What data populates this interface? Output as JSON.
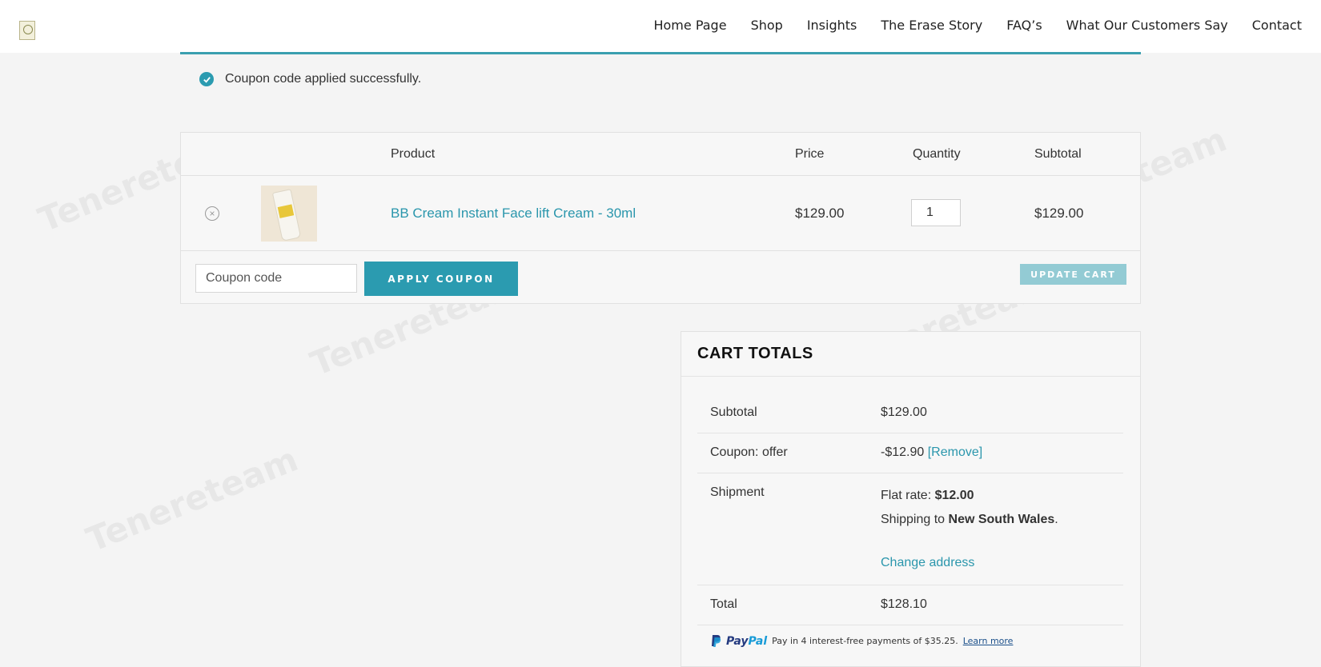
{
  "header": {
    "logo_name": "leaf-logo-icon",
    "nav": [
      "Home Page",
      "Shop",
      "Insights",
      "The Erase Story",
      "FAQ’s",
      "What Our Customers Say",
      "Contact"
    ]
  },
  "notice": {
    "text": "Coupon code applied successfully."
  },
  "cart": {
    "columns": [
      "Product",
      "Price",
      "Quantity",
      "Subtotal"
    ],
    "item": {
      "name": "BB Cream Instant Face lift Cream - 30ml",
      "price": "$129.00",
      "quantity": "1",
      "subtotal": "$129.00"
    },
    "coupon_placeholder": "Coupon code",
    "apply_label": "APPLY COUPON",
    "update_label": "UPDATE CART"
  },
  "totals": {
    "title": "CART TOTALS",
    "subtotal_label": "Subtotal",
    "subtotal": "$129.00",
    "coupon_label": "Coupon: offer",
    "coupon_value": "-$12.90",
    "coupon_remove": "[Remove]",
    "shipment_label": "Shipment",
    "flat_rate_prefix": "Flat rate:",
    "flat_rate": "$12.00",
    "shipping_to_prefix": "Shipping to",
    "shipping_to": "New South Wales",
    "shipping_to_suffix": ".",
    "change_address": "Change address",
    "total_label": "Total",
    "total": "$128.10"
  },
  "paypal": {
    "logo_a": "Pay",
    "logo_b": "Pal",
    "text": "Pay in 4 interest-free payments of $35.25.",
    "learn_more": "Learn more"
  },
  "watermark": "Tenereteam",
  "colors": {
    "accent": "#2b9bb0",
    "paypal_dark": "#253b80",
    "paypal_light": "#179bd7"
  }
}
